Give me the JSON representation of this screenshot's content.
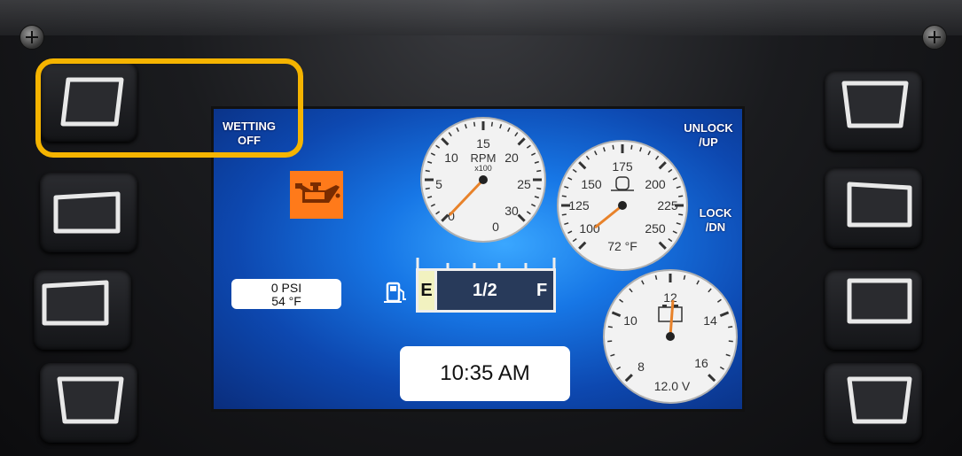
{
  "labels": {
    "wetting_line1": "WETTING",
    "wetting_line2": "OFF",
    "unlock_line1": "UNLOCK",
    "unlock_line2": "/UP",
    "lock_line1": "LOCK",
    "lock_line2": "/DN"
  },
  "tach": {
    "label": "RPM",
    "multiplier": "x100",
    "ticks": [
      "0",
      "5",
      "10",
      "15",
      "20",
      "25",
      "30",
      "0"
    ],
    "value": 0
  },
  "temp_gauge": {
    "ticks": [
      "100",
      "125",
      "150",
      "175",
      "200",
      "225",
      "250"
    ],
    "readout": "72 °F",
    "value": 72
  },
  "volt_gauge": {
    "ticks": [
      "8",
      "10",
      "12",
      "14",
      "16"
    ],
    "readout": "12.0 V",
    "value": 12.0
  },
  "pressure": {
    "line1": "0 PSI",
    "line2": "54 °F"
  },
  "fuel": {
    "empty": "E",
    "level_text": "1/2",
    "full": "F",
    "level": 0.5
  },
  "clock": "10:35 AM",
  "colors": {
    "highlight": "#f5b400",
    "needle": "#e8822a",
    "oil_warning": "#ff7a1a",
    "screen_blue": "#1777e6"
  },
  "icons": [
    "oil-can-icon",
    "fuel-pump-icon",
    "thermometer-icon",
    "battery-icon"
  ]
}
